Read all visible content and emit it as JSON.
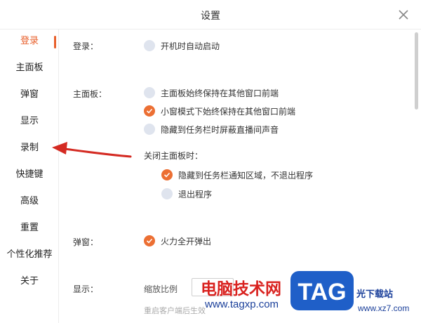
{
  "window": {
    "title": "设置"
  },
  "sidebar": {
    "items": [
      {
        "label": "登录",
        "active": true
      },
      {
        "label": "主面板"
      },
      {
        "label": "弹窗"
      },
      {
        "label": "显示"
      },
      {
        "label": "录制"
      },
      {
        "label": "快捷键"
      },
      {
        "label": "高级"
      },
      {
        "label": "重置"
      },
      {
        "label": "个性化推荐"
      },
      {
        "label": "关于"
      }
    ]
  },
  "sections": {
    "login": {
      "label": "登录：",
      "options": [
        {
          "text": "开机时自动启动",
          "checked": false
        }
      ]
    },
    "main_panel": {
      "label": "主面板：",
      "options": [
        {
          "text": "主面板始终保持在其他窗口前端",
          "checked": false
        },
        {
          "text": "小窗模式下始终保持在其他窗口前端",
          "checked": true
        },
        {
          "text": "隐藏到任务栏时屏蔽直播间声音",
          "checked": false
        }
      ],
      "close_label": "关闭主面板时：",
      "close_options": [
        {
          "text": "隐藏到任务栏通知区域，不退出程序",
          "checked": true
        },
        {
          "text": "退出程序",
          "checked": false
        }
      ]
    },
    "popup": {
      "label": "弹窗：",
      "options": [
        {
          "text": "火力全开弹出",
          "checked": true
        }
      ]
    },
    "display": {
      "label": "显示：",
      "scale_label": "缩放比例",
      "hint": "重启客户端后生效"
    }
  },
  "watermark": {
    "site_name": "电脑技术网",
    "site_url": "www.tagxp.com",
    "tag_logo": "TAG",
    "right_text": "光下载站",
    "right_url": "www.xz7.com"
  },
  "colors": {
    "accent": "#e8602c",
    "radio_checked": "#ec6f33",
    "radio_unchecked": "#dfe4ee",
    "arrow": "#d42a22"
  }
}
